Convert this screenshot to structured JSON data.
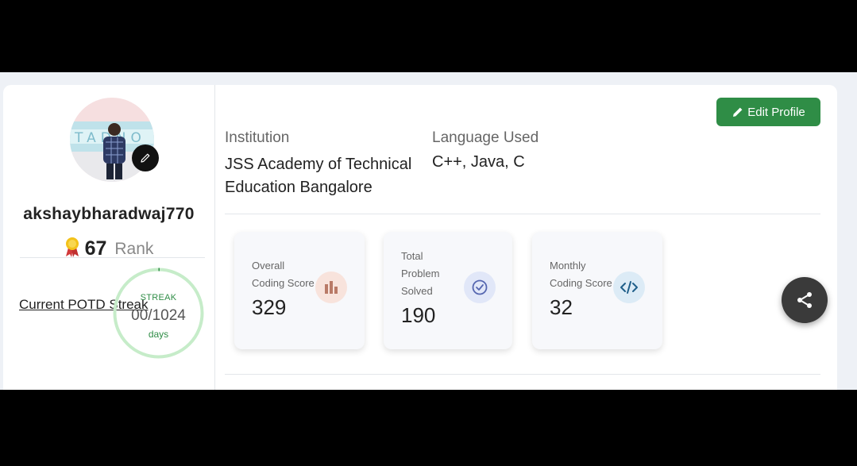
{
  "profile": {
    "username": "akshaybharadwaj770",
    "rank_number": "67",
    "rank_label": "Rank",
    "potd_link": "Current POTD Streak",
    "streak": {
      "label": "STREAK",
      "value": "00/1024",
      "days": "days",
      "progress": 0.0
    }
  },
  "header": {
    "edit_profile": "Edit Profile"
  },
  "details": {
    "institution_label": "Institution",
    "institution_value": "JSS Academy of Technical Education Bangalore",
    "language_label": "Language Used",
    "language_value": "C++, Java, C"
  },
  "stats": [
    {
      "label_lines": [
        "Overall",
        "Coding Score"
      ],
      "value": "329",
      "icon": "bar-chart-icon"
    },
    {
      "label_lines": [
        "Total",
        "Problem",
        "Solved"
      ],
      "value": "190",
      "icon": "check-circle-icon"
    },
    {
      "label_lines": [
        "Monthly",
        "Coding Score"
      ],
      "value": "32",
      "icon": "code-icon"
    }
  ],
  "colors": {
    "accent": "#2f8d46",
    "share_button": "#3a3a3a",
    "background": "#eef1f6"
  },
  "icons": {
    "edit_avatar": "pencil-icon",
    "rank": "medal-icon",
    "share": "share-icon",
    "edit_profile": "pencil-icon"
  }
}
